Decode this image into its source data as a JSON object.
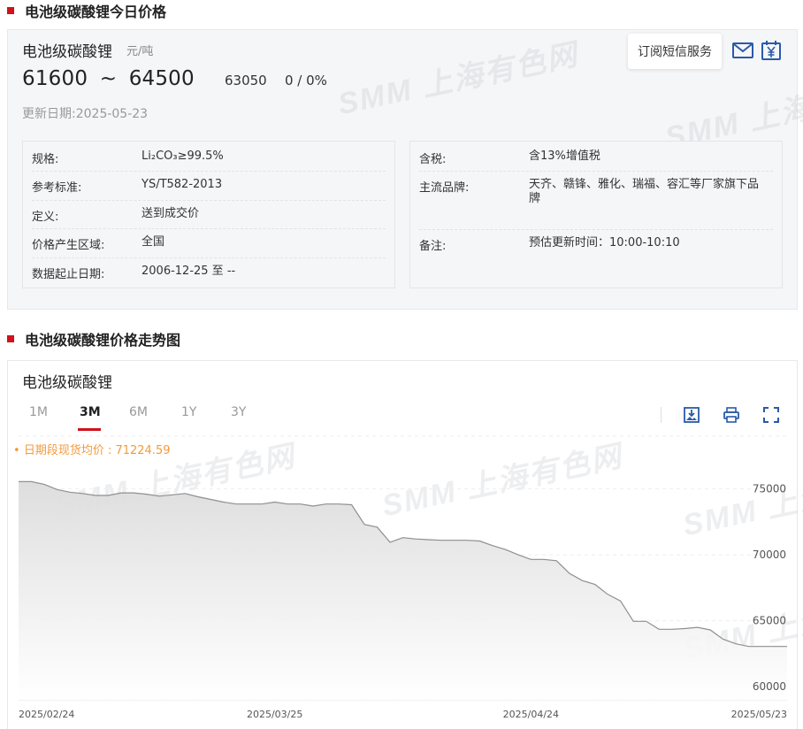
{
  "section1": {
    "title": "电池级碳酸锂今日价格"
  },
  "price": {
    "product": "电池级碳酸锂",
    "unit": "元/吨",
    "low": "61600",
    "tilde": "~",
    "high": "64500",
    "average": "63050",
    "change": "0 / 0%",
    "update_label": "更新日期:",
    "update_date": "2025-05-23",
    "subscribe_label": "订阅短信服务",
    "mail_icon": "mail-icon",
    "price_icon": "yuan-calendar-icon"
  },
  "specs_left": [
    {
      "key": "规格:",
      "value": "Li₂CO₃≥99.5%"
    },
    {
      "key": "参考标准:",
      "value": "YS/T582-2013"
    },
    {
      "key": "定义:",
      "value": "送到成交价"
    },
    {
      "key": "价格产生区域:",
      "value": "全国"
    },
    {
      "key": "数据起止日期:",
      "value": "2006-12-25 至 --"
    }
  ],
  "specs_right": [
    {
      "key": "含税:",
      "value": "含13%增值税"
    },
    {
      "key": "主流品牌:",
      "value": "天齐、赣锋、雅化、瑞福、容汇等厂家旗下品牌"
    },
    {
      "key": "备注:",
      "value": "预估更新时间：10:00-10:10"
    }
  ],
  "watermark": "SMM 上海有色网",
  "section2": {
    "title": "电池级碳酸锂价格走势图"
  },
  "chart": {
    "title": "电池级碳酸锂",
    "tabs": [
      "1M",
      "3M",
      "6M",
      "1Y",
      "3Y"
    ],
    "active_tab": "3M",
    "tools": [
      "download-image-icon",
      "print-icon",
      "fullscreen-icon"
    ],
    "legend_label": "日期段现货均价 : 71224.59",
    "accent": "#d0121b",
    "legend_color": "#f39a3c"
  },
  "chart_data": {
    "type": "area",
    "title": "电池级碳酸锂",
    "xlabel": "",
    "ylabel": "",
    "x_ticks": [
      "2025/02/24",
      "2025/03/25",
      "2025/04/24",
      "2025/05/23"
    ],
    "y_ticks": [
      60000,
      65000,
      70000,
      75000
    ],
    "ylim": [
      59000,
      79000
    ],
    "grid": true,
    "series": [
      {
        "name": "日期段现货均价",
        "values": [
          75550,
          75550,
          75350,
          74950,
          74750,
          74650,
          74500,
          74500,
          74700,
          74700,
          74600,
          74450,
          74550,
          74650,
          74400,
          74200,
          74000,
          73850,
          73850,
          73850,
          74000,
          73850,
          73850,
          73700,
          73850,
          73850,
          73800,
          72300,
          72100,
          70950,
          71300,
          71200,
          71150,
          71100,
          71100,
          71100,
          71050,
          70700,
          70400,
          70000,
          69650,
          69650,
          69550,
          68600,
          68050,
          67750,
          67000,
          66500,
          64950,
          64950,
          64350,
          64350,
          64400,
          64500,
          64300,
          63600,
          63250,
          63050,
          63050,
          63050,
          63050
        ]
      }
    ]
  }
}
